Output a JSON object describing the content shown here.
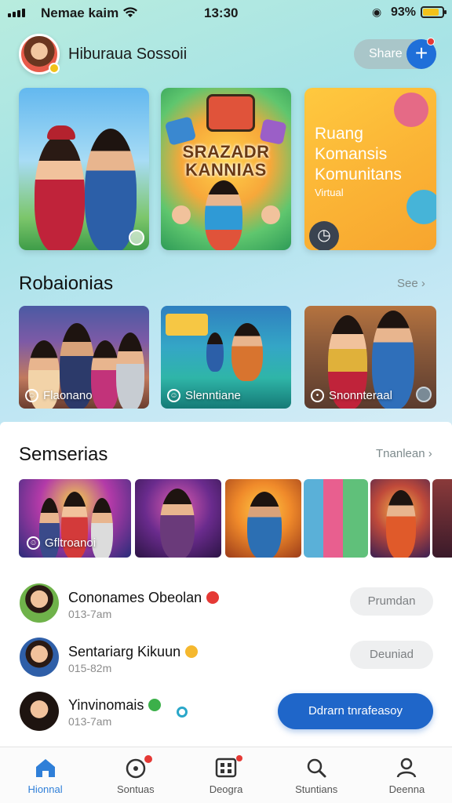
{
  "status_bar": {
    "carrier": "Nemae kaim",
    "time": "13:30",
    "battery": "93%",
    "battery_level": 0.93
  },
  "header": {
    "title": "Hiburaua Sossoii",
    "share_label": "Share",
    "share_plus": "+"
  },
  "featured": {
    "card2_title": "SRAZADR KANNIAS",
    "card3_title": "Ruang Komansis Komunitans",
    "card3_sub": "Virtual"
  },
  "recommendations": {
    "title": "Robaionias",
    "see_all": "See",
    "items": [
      {
        "label": "Flaonano"
      },
      {
        "label": "Slenntiane"
      },
      {
        "label": "Snonnteraal"
      }
    ]
  },
  "series": {
    "title": "Semserias",
    "see_all": "Tnanlean",
    "first_label": "Gfltroanoi"
  },
  "activity": [
    {
      "name": "Cononames Obeolan",
      "time": "013-7am",
      "button": "Prumdan",
      "emoji_color": "#e53935"
    },
    {
      "name": "Sentariarg Kikuun",
      "time": "015-82m",
      "button": "Deuniad",
      "emoji_color": "#f5b82e"
    },
    {
      "name": "Yinvinomais",
      "time": "013-7am",
      "button": "Ddrarn tnrafeasoy",
      "emoji_color": "#3cb04a"
    }
  ],
  "nav": [
    {
      "label": "Hionnal",
      "icon": "home-icon",
      "active": true
    },
    {
      "label": "Sontuas",
      "icon": "clock-icon",
      "active": false
    },
    {
      "label": "Deogra",
      "icon": "grid-icon",
      "active": false
    },
    {
      "label": "Stuntians",
      "icon": "search-icon",
      "active": false
    },
    {
      "label": "Deenna",
      "icon": "profile-icon",
      "active": false
    }
  ],
  "colors": {
    "accent": "#1f66c9",
    "active_nav": "#2f7fd8",
    "notification": "#e53935"
  }
}
